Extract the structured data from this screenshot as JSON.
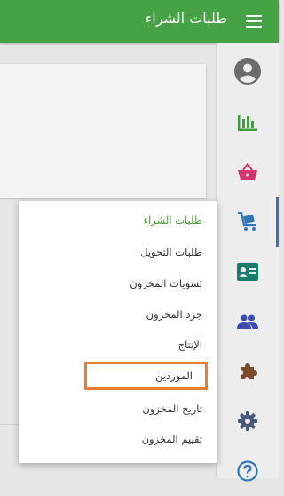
{
  "header": {
    "title": "طلبات الشراء",
    "menu_icon": "hamburger-menu-icon",
    "background": "#45a245"
  },
  "rail": {
    "items": [
      {
        "name": "profile",
        "icon": "user-circle-icon",
        "color": "#6b6b6b"
      },
      {
        "name": "reports",
        "icon": "bar-chart-icon",
        "color": "#3f9f3f"
      },
      {
        "name": "sales",
        "icon": "basket-icon",
        "color": "#d3366f"
      },
      {
        "name": "purchases",
        "icon": "cart-icon",
        "color": "#2f77b8",
        "active": true
      },
      {
        "name": "contacts",
        "icon": "contact-card-icon",
        "color": "#167e6a"
      },
      {
        "name": "users",
        "icon": "users-icon",
        "color": "#3b4bb2"
      },
      {
        "name": "addons",
        "icon": "puzzle-icon",
        "color": "#7a4b28"
      },
      {
        "name": "settings",
        "icon": "gear-icon",
        "color": "#44587a"
      },
      {
        "name": "help",
        "icon": "help-circle-icon",
        "color": "#2f77b8"
      }
    ]
  },
  "dropdown": {
    "items": [
      {
        "label": "طلبات الشراء",
        "active": true
      },
      {
        "label": "طلبات التحويل"
      },
      {
        "label": "تسويات المخزون"
      },
      {
        "label": "جرد المخزون"
      },
      {
        "label": "الإنتاج"
      },
      {
        "label": "الموردين",
        "highlighted": true
      },
      {
        "label": "تاريخ المخزون"
      },
      {
        "label": "تقييم المخزون"
      }
    ]
  },
  "colors": {
    "accent_green": "#45a245",
    "highlight_border": "#ea7e2e",
    "active_indicator": "#2f77b8"
  }
}
